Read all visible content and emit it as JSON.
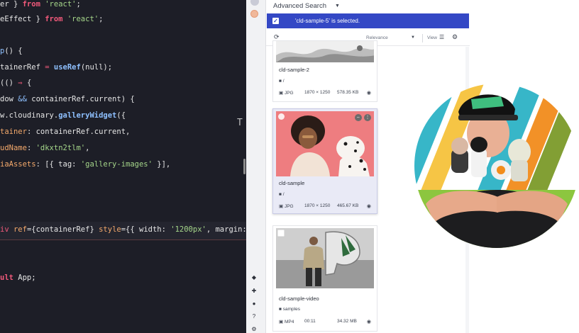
{
  "editor": {
    "lines": [
      "er } from 'react';",
      "eEffect } from 'react';",
      "p() {",
      "tainerRef = useRef(null);",
      "(() => {",
      "dow && containerRef.current) {",
      "w.cloudinary.galleryWidget({",
      "tainer: containerRef.current,",
      "udName: 'dkxtn2tlm',",
      "iaAssets: [{ tag: 'gallery-images' }],",
      "iv ref={containerRef} style={{ width: '1200px', margin: '",
      "ult App;"
    ],
    "cursor_glyph": "T"
  },
  "widget": {
    "advanced_search_label": "Advanced Search",
    "selection_message": "'cld-sample-5' is selected.",
    "sort_label": "Relevance",
    "view_label": "View",
    "icons": {
      "caret": "caret-down-icon",
      "check": "checkbox-icon",
      "refresh": "refresh-icon",
      "view": "list-view-icon",
      "settings": "gear-icon",
      "folder": "folder-icon",
      "image": "image-icon",
      "video": "video-icon",
      "globe": "globe-icon"
    },
    "cards": [
      {
        "title": "cld-sample-2",
        "folder": "/",
        "type": "JPG",
        "dimensions": "1870 × 1250",
        "size": "578.35 KB"
      },
      {
        "title": "cld-sample",
        "folder": "/",
        "type": "JPG",
        "dimensions": "1870 × 1250",
        "size": "465.67 KB"
      },
      {
        "title": "cld-sample-video",
        "folder": "samples",
        "type": "MP4",
        "dimensions": "00:11",
        "size": "34.32 MB"
      }
    ]
  },
  "colors": {
    "editor_bg": "#1d1e27",
    "keyword": "#f0597a",
    "string": "#a5d68a",
    "function": "#8ec0ff",
    "selection_bar": "#3448c5",
    "selected_card": "#e9eaf6"
  }
}
